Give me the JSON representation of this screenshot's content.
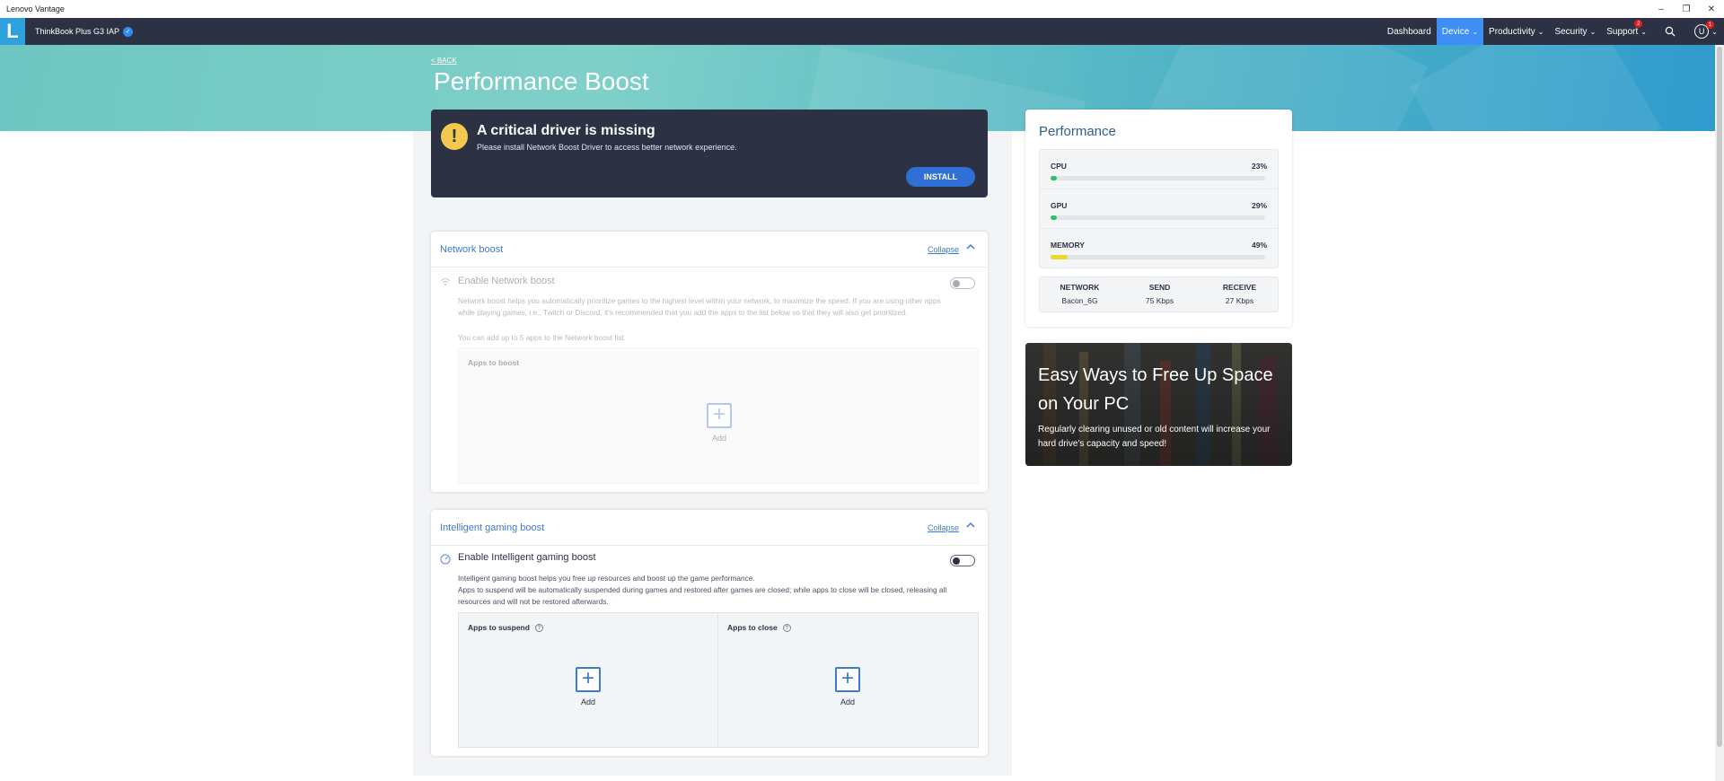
{
  "window": {
    "title": "Lenovo Vantage",
    "controls": {
      "minimize": "–",
      "restore": "❐",
      "close": "✕"
    }
  },
  "navbar": {
    "logo": "L",
    "device_name": "ThinkBook Plus G3 IAP",
    "items": [
      {
        "label": "Dashboard",
        "active": false
      },
      {
        "label": "Device",
        "active": true
      },
      {
        "label": "Productivity",
        "active": false
      },
      {
        "label": "Security",
        "active": false
      },
      {
        "label": "Support",
        "active": false,
        "badge": "2"
      }
    ],
    "user_initial": "U",
    "user_badge": "1",
    "chevron": "⌄",
    "search_glyph": "⌕"
  },
  "page": {
    "back_label": "< BACK",
    "title": "Performance Boost"
  },
  "critical_banner": {
    "icon": "!",
    "title": "A critical driver is missing",
    "description": "Please install Network Boost Driver to access better network experience.",
    "button_label": "INSTALL"
  },
  "network_boost": {
    "header": "Network boost",
    "collapse_label": "Collapse",
    "feature_title": "Enable Network boost",
    "description": "Network boost helps you automatically prioritize games to the highest level within your network, to maximize the speed. If you are using other apps while playing games, i.e., Twitch or Discord, it's recommended that you add the apps to the list below so that they will also get prioritized.",
    "limit_note": "You can add up to 5 apps to the Network boost list.",
    "apps_label": "Apps to boost",
    "add_label": "Add",
    "enabled": false
  },
  "gaming_boost": {
    "header": "Intelligent gaming boost",
    "collapse_label": "Collapse",
    "feature_title": "Enable Intelligent gaming boost",
    "description_1": "Intelligent gaming boost helps you free up resources and boost up the game performance.",
    "description_2": "Apps to suspend will be automatically suspended during games and restored after games are closed; while apps to close will be closed, releasing all resources and will not be restored afterwards.",
    "suspend_label": "Apps to suspend",
    "close_label": "Apps to close",
    "add_label": "Add",
    "help_glyph": "?",
    "enabled": false
  },
  "performance": {
    "title": "Performance",
    "metrics": [
      {
        "label": "CPU",
        "value": "23%",
        "fraction": 0.03,
        "color": "#27c26a"
      },
      {
        "label": "GPU",
        "value": "29%",
        "fraction": 0.03,
        "color": "#27c26a"
      },
      {
        "label": "MEMORY",
        "value": "49%",
        "fraction": 0.08,
        "color": "#e9d92a"
      }
    ],
    "network": [
      {
        "heading": "NETWORK",
        "value": "Bacon_6G"
      },
      {
        "heading": "SEND",
        "value": "75 Kbps"
      },
      {
        "heading": "RECEIVE",
        "value": "27 Kbps"
      }
    ]
  },
  "promo": {
    "title": "Easy Ways to Free Up Space on Your PC",
    "description": "Regularly clearing unused or old content will increase your hard drive's capacity and speed!"
  }
}
